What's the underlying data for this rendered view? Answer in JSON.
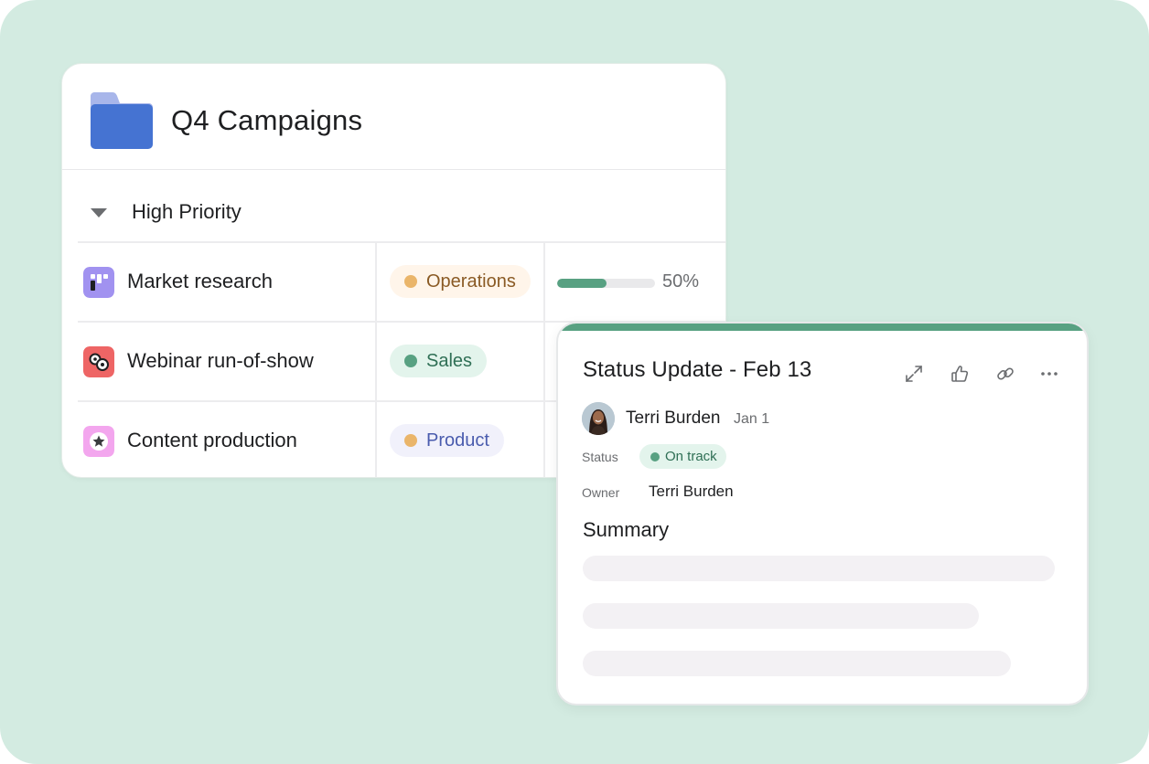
{
  "project": {
    "title": "Q4 Campaigns",
    "icon": "folder-icon",
    "section": {
      "title": "High Priority",
      "collapse_icon": "caret-down-icon"
    },
    "tasks": [
      {
        "name": "Market research",
        "icon": "board-icon",
        "icon_color": "#a192f0",
        "tag": {
          "label": "Operations",
          "dot_color": "#eab56a",
          "bg": "#fff5ea",
          "text_color": "#8a5a24"
        },
        "progress": {
          "value": 0.5,
          "label": "50%"
        }
      },
      {
        "name": "Webinar run-of-show",
        "icon": "gears-icon",
        "icon_color": "#ee6565",
        "tag": {
          "label": "Sales",
          "dot_color": "#58a182",
          "bg": "#e3f4ec",
          "text_color": "#2f6f55"
        }
      },
      {
        "name": "Content production",
        "icon": "star-badge-icon",
        "icon_color": "#f3a6ee",
        "tag": {
          "label": "Product",
          "dot_color": "#eab56a",
          "bg": "#f1f1fb",
          "text_color": "#4a5cae"
        }
      }
    ]
  },
  "status_update": {
    "title": "Status Update - Feb 13",
    "accent_color": "#58a182",
    "actions": [
      {
        "name": "expand-icon"
      },
      {
        "name": "thumbs-up-icon"
      },
      {
        "name": "link-icon"
      },
      {
        "name": "more-icon"
      }
    ],
    "author": {
      "name": "Terri Burden",
      "date": "Jan 1"
    },
    "fields": {
      "status_label": "Status",
      "status_value": "On track",
      "owner_label": "Owner",
      "owner_value": "Terri Burden"
    },
    "summary_title": "Summary"
  }
}
